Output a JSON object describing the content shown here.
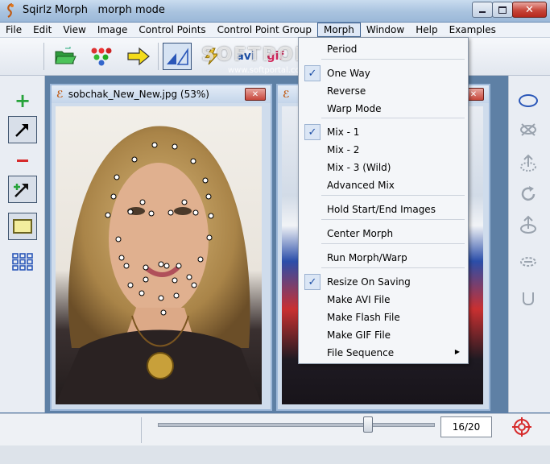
{
  "window": {
    "app_name": "Sqirlz Morph",
    "mode": "morph mode"
  },
  "menubar": [
    "File",
    "Edit",
    "View",
    "Image",
    "Control Points",
    "Control Point Group",
    "Morph",
    "Window",
    "Help",
    "Examples"
  ],
  "active_menu": "Morph",
  "morph_menu": {
    "items": [
      {
        "label": "Period",
        "checked": false
      },
      {
        "label": "One Way",
        "checked": true
      },
      {
        "label": "Reverse",
        "checked": false
      },
      {
        "label": "Warp Mode",
        "checked": false
      },
      {
        "label": "Mix - 1",
        "checked": true
      },
      {
        "label": "Mix - 2",
        "checked": false
      },
      {
        "label": "Mix - 3 (Wild)",
        "checked": false
      },
      {
        "label": "Advanced Mix",
        "checked": false
      },
      {
        "label": "Hold Start/End Images",
        "checked": false
      },
      {
        "label": "Center Morph",
        "checked": false
      },
      {
        "label": "Run Morph/Warp",
        "checked": false
      },
      {
        "label": "Resize On Saving",
        "checked": true
      },
      {
        "label": "Make AVI File",
        "checked": false
      },
      {
        "label": "Make Flash File",
        "checked": false
      },
      {
        "label": "Make GIF File",
        "checked": false
      },
      {
        "label": "File Sequence",
        "checked": false,
        "submenu": true
      }
    ]
  },
  "toolbar": {
    "avi_label": "avi",
    "gif_label": "gif"
  },
  "image_window_1": {
    "title": "sobchak_New_New.jpg  (53%)"
  },
  "status": {
    "frame_counter": "16/20",
    "slider_progress": 0.76
  },
  "watermark": {
    "text": "SOFTPORTAL",
    "url": "www.softportal.com"
  },
  "colors": {
    "accent_blue": "#1d4fa6",
    "plus_green": "#27a33a",
    "minus_red": "#d62b2b"
  }
}
